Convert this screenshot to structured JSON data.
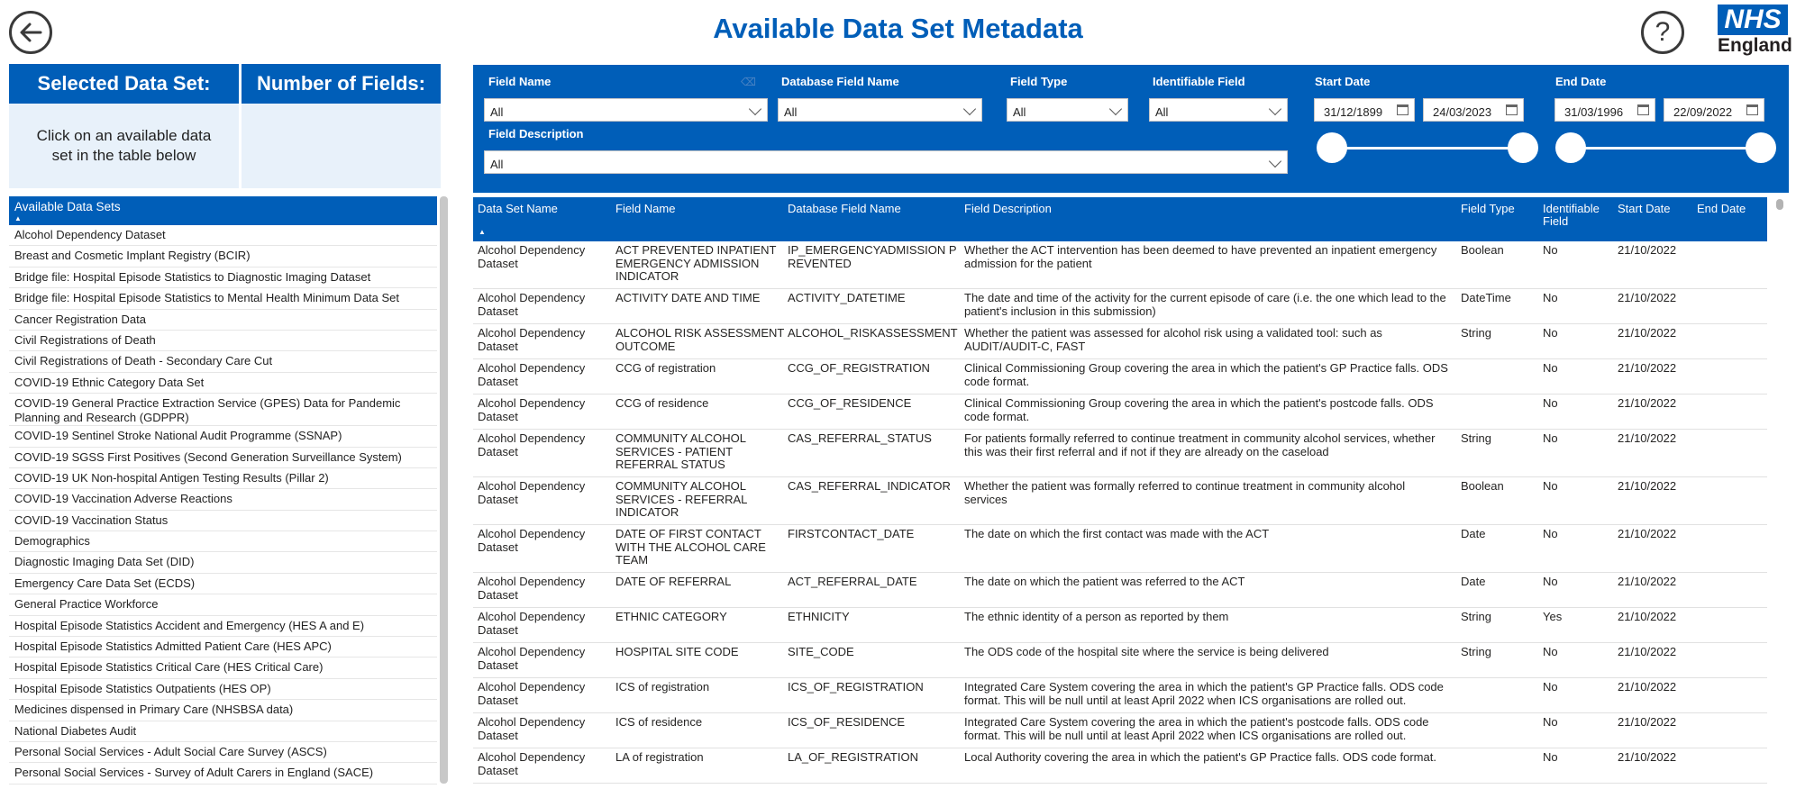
{
  "header": {
    "title": "Available Data Set Metadata",
    "help_glyph": "?",
    "logo_main": "NHS",
    "logo_sub": "England"
  },
  "selected_panel": {
    "col1_header": "Selected Data Set:",
    "col2_header": "Number of Fields:",
    "col1_value": "Click on an available data set in the table below",
    "col2_value": ""
  },
  "available": {
    "header": "Available Data Sets",
    "sort_glyph": "▲",
    "items": [
      "Alcohol Dependency Dataset",
      "Breast and Cosmetic Implant Registry (BCIR)",
      "Bridge file: Hospital Episode Statistics to Diagnostic Imaging Dataset",
      "Bridge file: Hospital Episode Statistics to Mental Health Minimum Data Set",
      "Cancer Registration Data",
      "Civil Registrations of Death",
      "Civil Registrations of Death - Secondary Care Cut",
      "COVID-19 Ethnic Category Data Set",
      "COVID-19 General Practice Extraction Service (GPES) Data for Pandemic Planning and Research (GDPPR)",
      "COVID-19 Sentinel Stroke National Audit Programme (SSNAP)",
      "COVID-19 SGSS First Positives (Second Generation Surveillance System)",
      "COVID-19 UK Non-hospital Antigen Testing Results (Pillar 2)",
      "COVID-19 Vaccination Adverse Reactions",
      "COVID-19 Vaccination Status",
      "Demographics",
      "Diagnostic Imaging Data Set (DID)",
      "Emergency Care Data Set (ECDS)",
      "General Practice Workforce",
      "Hospital Episode Statistics Accident and Emergency (HES A and E)",
      "Hospital Episode Statistics Admitted Patient Care (HES APC)",
      "Hospital Episode Statistics Critical Care (HES Critical Care)",
      "Hospital Episode Statistics Outpatients (HES OP)",
      "Medicines dispensed in Primary Care (NHSBSA data)",
      "National Diabetes Audit",
      "Personal Social Services - Adult Social Care Survey (ASCS)",
      "Personal Social Services - Survey of Adult Carers in England (SACE)"
    ]
  },
  "filters": {
    "field_name": {
      "label": "Field Name",
      "value": "All"
    },
    "db_field_name": {
      "label": "Database Field Name",
      "value": "All"
    },
    "field_type": {
      "label": "Field Type",
      "value": "All"
    },
    "identifiable": {
      "label": "Identifiable Field",
      "value": "All"
    },
    "field_description": {
      "label": "Field Description",
      "value": "All"
    },
    "start_date": {
      "label": "Start Date",
      "from": "31/12/1899",
      "to": "24/03/2023"
    },
    "end_date": {
      "label": "End Date",
      "from": "31/03/1996",
      "to": "22/09/2022"
    }
  },
  "table": {
    "columns": [
      "Data Set Name",
      "Field Name",
      "Database Field Name",
      "Field Description",
      "Field Type",
      "Identifiable Field",
      "Start Date",
      "End Date"
    ],
    "sort_glyph": "▲",
    "rows": [
      {
        "ds": "Alcohol Dependency Dataset",
        "fn": "ACT PREVENTED INPATIENT EMERGENCY ADMISSION INDICATOR",
        "db": "IP_EMERGENCYADMISSION PREVENTED",
        "desc": "Whether the ACT intervention has been deemed to have prevented an inpatient emergency admission for the patient",
        "ft": "Boolean",
        "id": "No",
        "sd": "21/10/2022",
        "ed": ""
      },
      {
        "ds": "Alcohol Dependency Dataset",
        "fn": "ACTIVITY DATE AND TIME",
        "db": "ACTIVITY_DATETIME",
        "desc": "The date and time of the activity for the current episode of care (i.e. the one which lead to the patient's inclusion in this submission)",
        "ft": "DateTime",
        "id": "No",
        "sd": "21/10/2022",
        "ed": ""
      },
      {
        "ds": "Alcohol Dependency Dataset",
        "fn": "ALCOHOL RISK ASSESSMENT OUTCOME",
        "db": "ALCOHOL_RISKASSESSMENT",
        "desc": "Whether the patient was assessed for alcohol risk using a validated tool: such as AUDIT/AUDIT-C, FAST",
        "ft": "String",
        "id": "No",
        "sd": "21/10/2022",
        "ed": ""
      },
      {
        "ds": "Alcohol Dependency Dataset",
        "fn": "CCG of registration",
        "db": "CCG_OF_REGISTRATION",
        "desc": "Clinical Commissioning Group covering the area in which the patient's GP Practice falls. ODS code format.",
        "ft": "",
        "id": "No",
        "sd": "21/10/2022",
        "ed": ""
      },
      {
        "ds": "Alcohol Dependency Dataset",
        "fn": "CCG of residence",
        "db": "CCG_OF_RESIDENCE",
        "desc": "Clinical Commissioning Group covering the area in which the patient's postcode falls. ODS code format.",
        "ft": "",
        "id": "No",
        "sd": "21/10/2022",
        "ed": ""
      },
      {
        "ds": "Alcohol Dependency Dataset",
        "fn": "COMMUNITY ALCOHOL SERVICES - PATIENT REFERRAL STATUS",
        "db": "CAS_REFERRAL_STATUS",
        "desc": "For patients formally referred to continue treatment in community alcohol services, whether this was their first referral and if not if they are already on the caseload",
        "ft": "String",
        "id": "No",
        "sd": "21/10/2022",
        "ed": ""
      },
      {
        "ds": "Alcohol Dependency Dataset",
        "fn": "COMMUNITY ALCOHOL SERVICES - REFERRAL INDICATOR",
        "db": "CAS_REFERRAL_INDICATOR",
        "desc": "Whether the patient was formally referred to continue treatment in community alcohol services",
        "ft": "Boolean",
        "id": "No",
        "sd": "21/10/2022",
        "ed": ""
      },
      {
        "ds": "Alcohol Dependency Dataset",
        "fn": "DATE OF FIRST CONTACT WITH THE ALCOHOL CARE TEAM",
        "db": "FIRSTCONTACT_DATE",
        "desc": "The date on which the first contact was made with the ACT",
        "ft": "Date",
        "id": "No",
        "sd": "21/10/2022",
        "ed": ""
      },
      {
        "ds": "Alcohol Dependency Dataset",
        "fn": "DATE OF REFERRAL",
        "db": "ACT_REFERRAL_DATE",
        "desc": "The date on which the patient was referred to the ACT",
        "ft": "Date",
        "id": "No",
        "sd": "21/10/2022",
        "ed": ""
      },
      {
        "ds": "Alcohol Dependency Dataset",
        "fn": "ETHNIC CATEGORY",
        "db": "ETHNICITY",
        "desc": "The ethnic identity of a person as reported by them",
        "ft": "String",
        "id": "Yes",
        "sd": "21/10/2022",
        "ed": ""
      },
      {
        "ds": "Alcohol Dependency Dataset",
        "fn": "HOSPITAL SITE CODE",
        "db": "SITE_CODE",
        "desc": "The ODS code of the hospital site where the service is being delivered",
        "ft": "String",
        "id": "No",
        "sd": "21/10/2022",
        "ed": ""
      },
      {
        "ds": "Alcohol Dependency Dataset",
        "fn": "ICS of registration",
        "db": "ICS_OF_REGISTRATION",
        "desc": "Integrated Care System covering the area in which the patient's GP Practice falls. ODS code format. This will be null until at least April 2022 when ICS organisations are rolled out.",
        "ft": "",
        "id": "No",
        "sd": "21/10/2022",
        "ed": ""
      },
      {
        "ds": "Alcohol Dependency Dataset",
        "fn": "ICS of residence",
        "db": "ICS_OF_RESIDENCE",
        "desc": "Integrated Care System covering the area in which the patient's postcode falls. ODS code format. This will be null until at least April 2022 when ICS organisations are rolled out.",
        "ft": "",
        "id": "No",
        "sd": "21/10/2022",
        "ed": ""
      },
      {
        "ds": "Alcohol Dependency Dataset",
        "fn": "LA of registration",
        "db": "LA_OF_REGISTRATION",
        "desc": "Local Authority covering the area in which the patient's GP Practice falls. ODS code format.",
        "ft": "",
        "id": "No",
        "sd": "21/10/2022",
        "ed": ""
      }
    ]
  }
}
